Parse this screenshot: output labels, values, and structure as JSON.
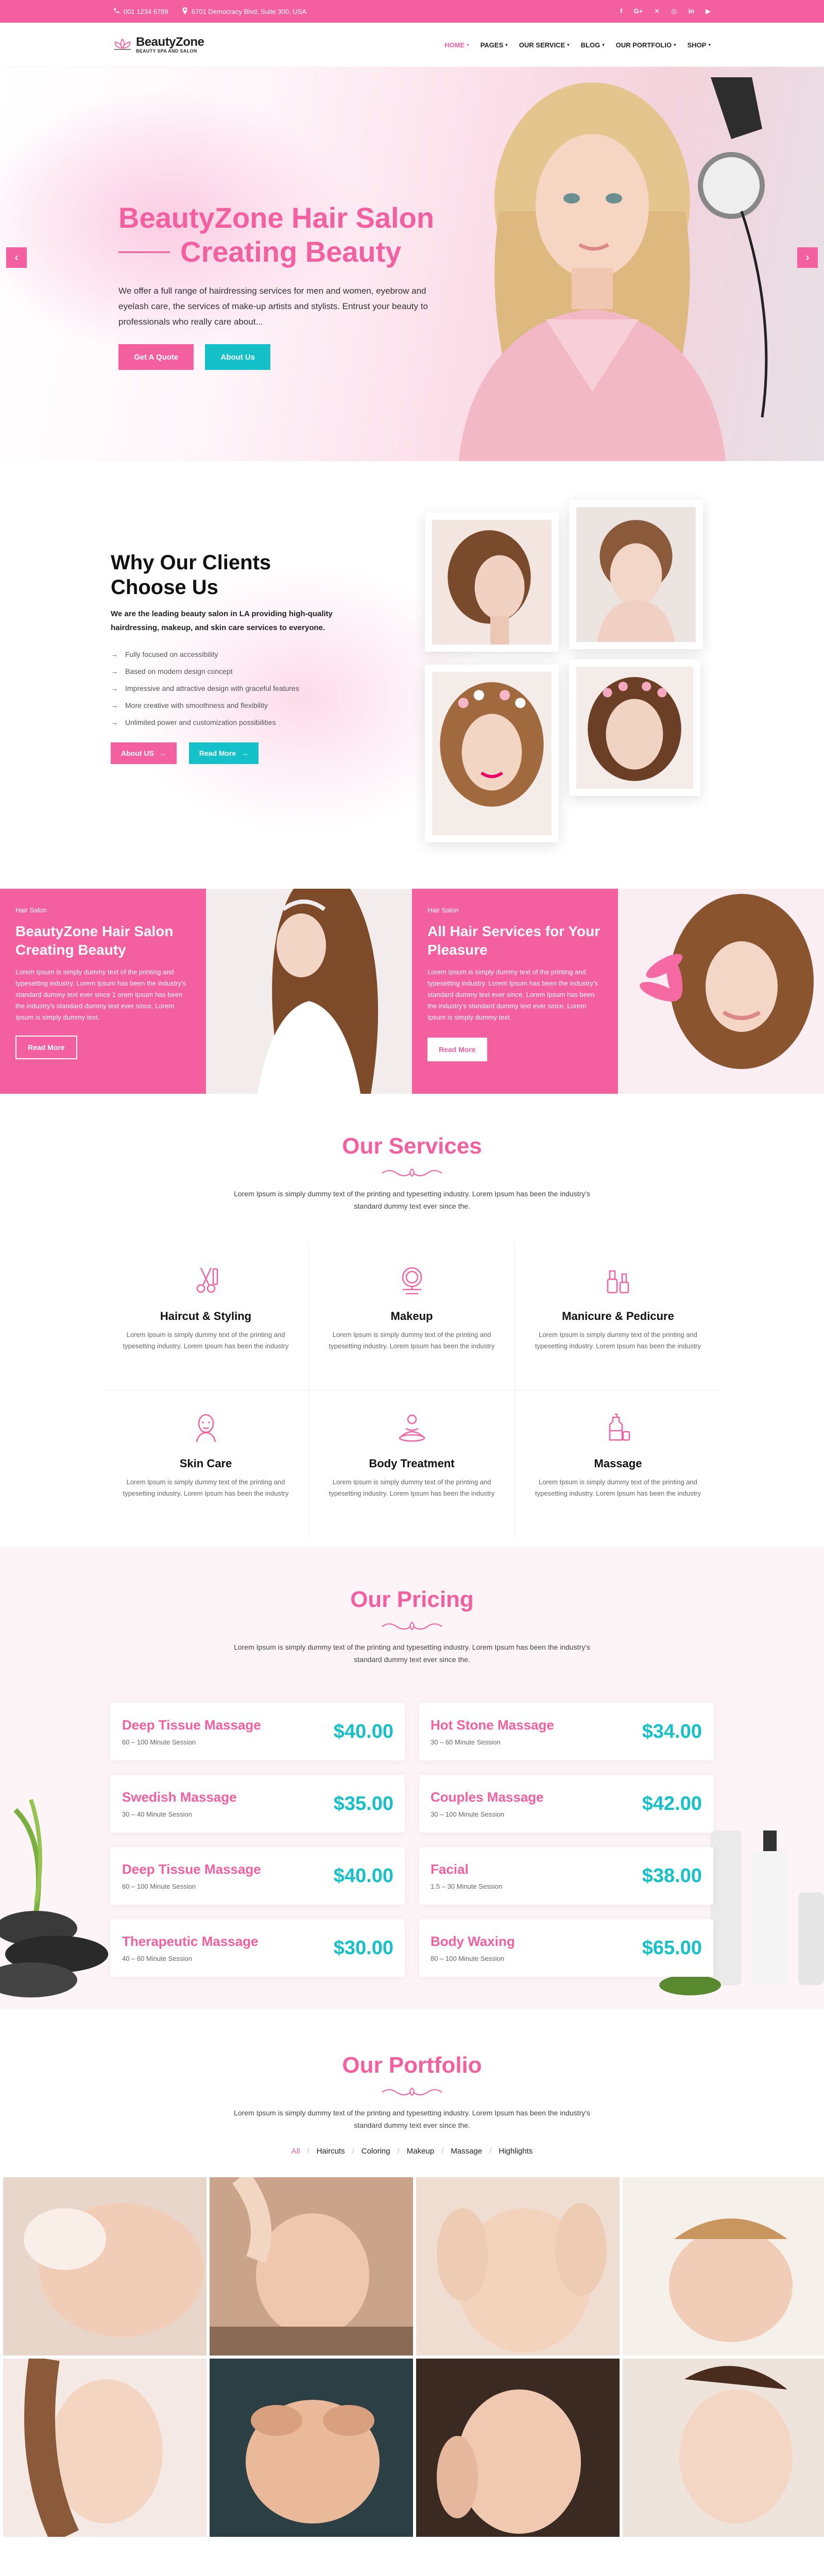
{
  "topbar": {
    "phone": "001 1234 6789",
    "address": "6701 Democracy Blvd, Suite 300, USA",
    "socials": [
      "f",
      "G+",
      "✕",
      "◎",
      "in",
      "▶"
    ]
  },
  "header": {
    "brand": "BeautyZone",
    "brand_sub": "BEAUTY SPA AND SALON",
    "nav": [
      {
        "label": "HOME"
      },
      {
        "label": "PAGES"
      },
      {
        "label": "OUR SERVICE"
      },
      {
        "label": "BLOG"
      },
      {
        "label": "OUR PORTFOLIO"
      },
      {
        "label": "SHOP"
      }
    ]
  },
  "hero": {
    "title1": "BeautyZone Hair Salon",
    "title2": "Creating Beauty",
    "text": "We offer a full range of hairdressing services for men and women, eyebrow and eyelash care, the services of make-up artists and stylists. Entrust your beauty to professionals who really care about...",
    "btn_quote": "Get A Quote",
    "btn_about": "About Us",
    "prev": "‹",
    "next": "›"
  },
  "why": {
    "title1": "Why Our Clients",
    "title2": "Choose Us",
    "lead": "We are the leading beauty salon in LA providing high-quality hairdressing, makeup, and skin care services to everyone.",
    "features": [
      "Fully focused on accessibility",
      "Based on modern design concept",
      "Impressive and attractive design with graceful features",
      "More creative with smoothness and flexibility",
      "Unlimited power and customization possibilities"
    ],
    "btn_about": "About US",
    "btn_read": "Read More"
  },
  "promos": [
    {
      "tag": "Hair Salon",
      "title": "BeautyZone Hair Salon Creating Beauty",
      "text": "Lorem Ipsum is simply dummy text of the printing and typesetting industry. Lorem Ipsum has been the industry's standard dummy text ever since 1 orem Ipsum has been the industry's standard dummy text ever since. Lorem Ipsum is simply dummy text.",
      "btn": "Read More"
    },
    {
      "tag": "Hair Salon",
      "title": "All Hair Services for Your Pleasure",
      "text": "Lorem Ipsum is simply dummy text of the printing and typesetting industry. Lorem Ipsum has been the industry's standard dummy text ever since. Lorem Ipsum has been the industry's standard dummy text ever since. Lorem Ipsum is simply dummy text.",
      "btn": "Read More"
    }
  ],
  "services": {
    "title": "Our Services",
    "text": "Lorem Ipsum is simply dummy text of the printing and typesetting industry. Lorem Ipsum has been the industry's standard dummy text ever since the.",
    "items": [
      {
        "title": "Haircut & Styling",
        "text": "Lorem Ipsum is simply dummy text of the printing and typesetting industry. Lorem Ipsum has been the industry"
      },
      {
        "title": "Makeup",
        "text": "Lorem Ipsum is simply dummy text of the printing and typesetting industry. Lorem Ipsum has been the industry"
      },
      {
        "title": "Manicure & Pedicure",
        "text": "Lorem Ipsum is simply dummy text of the printing and typesetting industry. Lorem Ipsum has been the industry"
      },
      {
        "title": "Skin Care",
        "text": "Lorem Ipsum is simply dummy text of the printing and typesetting industry. Lorem Ipsum has been the industry"
      },
      {
        "title": "Body Treatment",
        "text": "Lorem Ipsum is simply dummy text of the printing and typesetting industry. Lorem Ipsum has been the industry"
      },
      {
        "title": "Massage",
        "text": "Lorem Ipsum is simply dummy text of the printing and typesetting industry. Lorem Ipsum has been the industry"
      }
    ]
  },
  "pricing": {
    "title": "Our Pricing",
    "text": "Lorem Ipsum is simply dummy text of the printing and typesetting industry. Lorem Ipsum has been the industry's standard dummy text ever since the.",
    "items": [
      {
        "name": "Deep Tissue Massage",
        "duration": "60 – 100 Minute Session",
        "price": "$40.00"
      },
      {
        "name": "Hot Stone Massage",
        "duration": "30 – 60 Minute Session",
        "price": "$34.00"
      },
      {
        "name": "Swedish Massage",
        "duration": "30 – 40 Minute Session",
        "price": "$35.00"
      },
      {
        "name": "Couples Massage",
        "duration": "30 – 100 Minute Session",
        "price": "$42.00"
      },
      {
        "name": "Deep Tissue Massage",
        "duration": "60 – 100 Minute Session",
        "price": "$40.00"
      },
      {
        "name": "Facial",
        "duration": "1.5 – 30 Minute Session",
        "price": "$38.00"
      },
      {
        "name": "Therapeutic Massage",
        "duration": "40 – 60 Minute Session",
        "price": "$30.00"
      },
      {
        "name": "Body Waxing",
        "duration": "80 – 100 Minute Session",
        "price": "$65.00"
      }
    ]
  },
  "portfolio": {
    "title": "Our Portfolio",
    "text": "Lorem Ipsum is simply dummy text of the printing and typesetting industry. Lorem Ipsum has been the industry's standard dummy text ever since the.",
    "filters": [
      "All",
      "Haircuts",
      "Coloring",
      "Makeup",
      "Massage",
      "Highlights"
    ]
  },
  "colors": {
    "accent": "#f45fa0",
    "teal": "#14c1c8"
  }
}
